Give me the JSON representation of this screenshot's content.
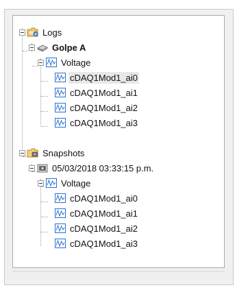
{
  "tree": {
    "logs": {
      "label": "Logs",
      "group": {
        "label": "Golpe A",
        "channel_group": "Voltage",
        "channels": [
          "cDAQ1Mod1_ai0",
          "cDAQ1Mod1_ai1",
          "cDAQ1Mod1_ai2",
          "cDAQ1Mod1_ai3"
        ]
      }
    },
    "snapshots": {
      "label": "Snapshots",
      "snapshot": {
        "label": "05/03/2018 03:33:15 p.m.",
        "channel_group": "Voltage",
        "channels": [
          "cDAQ1Mod1_ai0",
          "cDAQ1Mod1_ai1",
          "cDAQ1Mod1_ai2",
          "cDAQ1Mod1_ai3"
        ]
      }
    }
  }
}
